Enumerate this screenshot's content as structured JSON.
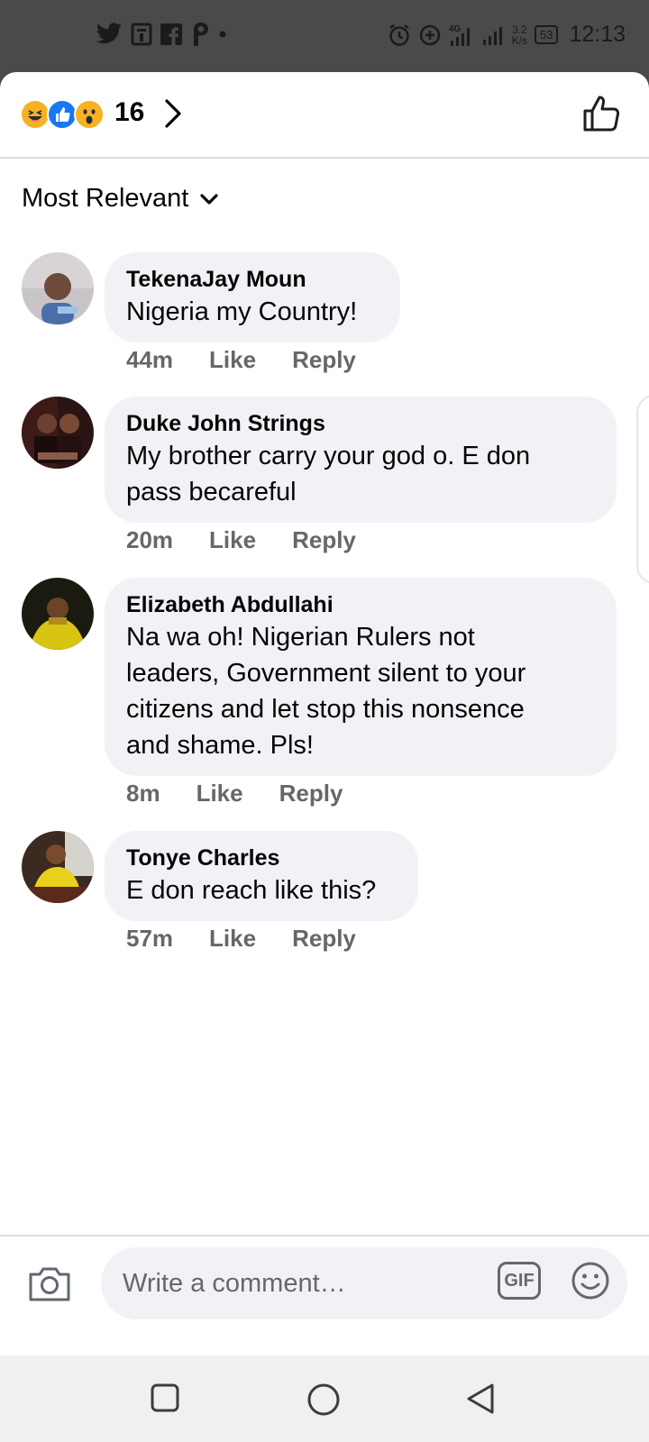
{
  "status_bar": {
    "time": "12:13",
    "net_speed_value": "3.2",
    "net_speed_unit": "K/s",
    "battery": "53",
    "network": "4G",
    "left_icons": [
      "twitter-icon",
      "gallery-icon",
      "facebook-icon",
      "pinterest-icon",
      "dot-icon"
    ],
    "right_icons": [
      "alarm-icon",
      "data-saver-icon",
      "signal-4g-icon",
      "signal-icon"
    ]
  },
  "reactions": {
    "emojis": [
      "haha",
      "like",
      "wow"
    ],
    "count": "16"
  },
  "sort": {
    "label": "Most Relevant"
  },
  "comments": [
    {
      "name": "TekenaJay Moun",
      "text_lines": [
        "Nigeria my Country!"
      ],
      "time": "44m",
      "like": "Like",
      "reply": "Reply"
    },
    {
      "name": "Duke John Strings",
      "text_lines": [
        "My brother carry your god o. E don",
        "pass becareful"
      ],
      "time": "20m",
      "like": "Like",
      "reply": "Reply"
    },
    {
      "name": "Elizabeth Abdullahi",
      "text_lines": [
        "Na wa oh! Nigerian Rulers not",
        "leaders,  Government silent to your",
        "citizens and let stop this nonsence",
        "and shame. Pls!"
      ],
      "time": "8m",
      "like": "Like",
      "reply": "Reply"
    },
    {
      "name": "Tonye Charles",
      "text_lines": [
        "E don reach like this?"
      ],
      "time": "57m",
      "like": "Like",
      "reply": "Reply"
    }
  ],
  "composer": {
    "placeholder": "Write a comment…",
    "gif_label": "GIF"
  },
  "colors": {
    "bubble": "#f0f2f5",
    "meta_text": "#65676b",
    "like_blue": "#1877f2",
    "status_bar": "#4a4a4a"
  }
}
